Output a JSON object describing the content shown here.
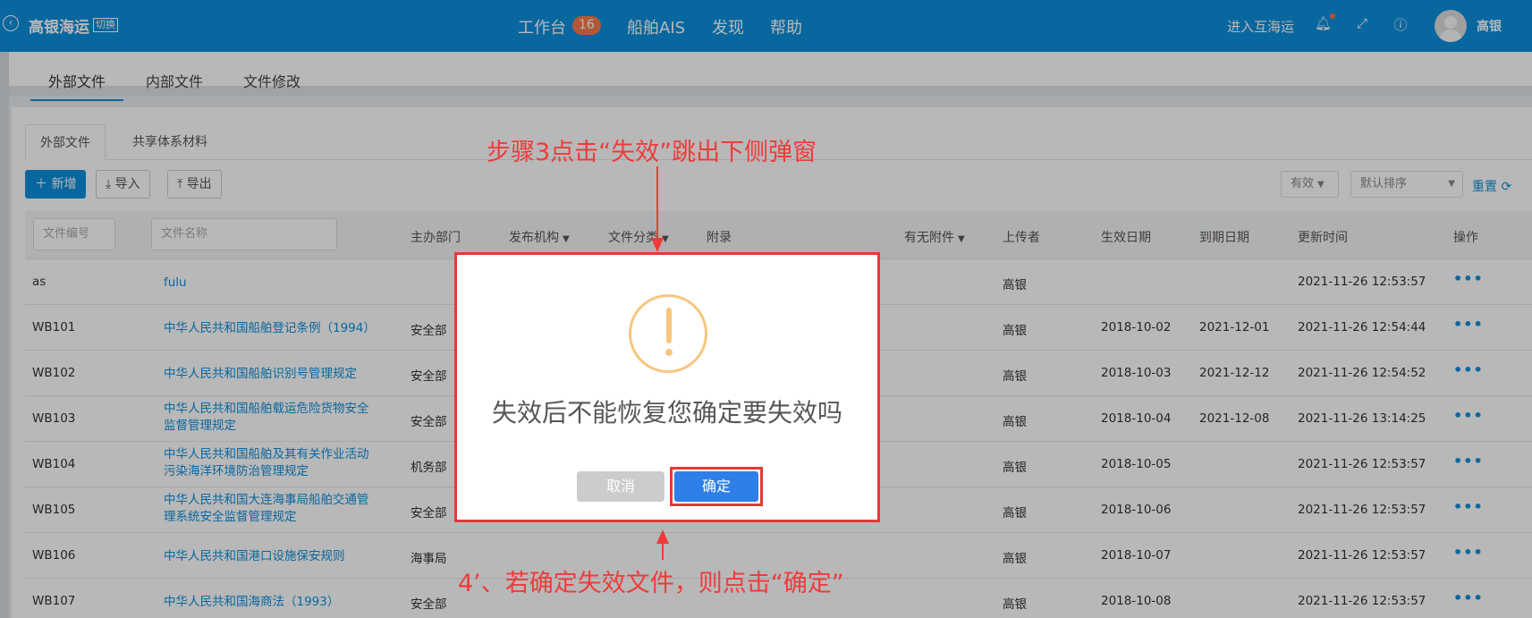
{
  "topbar": {
    "back_icon": "arrow-left-circle-icon",
    "company": "高银海运",
    "switch": "切换",
    "nav": [
      {
        "label": "工作台"
      },
      {
        "label": "船舶AIS"
      },
      {
        "label": "发现"
      },
      {
        "label": "帮助"
      }
    ],
    "badge_count": "16",
    "enter_link": "进入互海运",
    "icons": [
      "bell-icon",
      "fullscreen-icon",
      "help-icon"
    ],
    "user_name": "高银"
  },
  "top_tabs": [
    "外部文件",
    "内部文件",
    "文件修改"
  ],
  "sub_tabs": [
    "外部文件",
    "共享体系材料"
  ],
  "toolbar": {
    "add": "新增",
    "import": "导入",
    "export": "导出",
    "status_filter": "有效",
    "sort": "默认排序",
    "reset": "重置"
  },
  "table": {
    "filters": {
      "code_placeholder": "文件编号",
      "name_placeholder": "文件名称"
    },
    "headers": [
      "主办部门",
      "发布机构",
      "文件分类",
      "附录",
      "有无附件",
      "上传者",
      "生效日期",
      "到期日期",
      "更新时间",
      "操作"
    ],
    "rows": [
      {
        "code": "as",
        "name": "fulu",
        "dept": "",
        "uploader": "高银",
        "effective": "",
        "expire": "",
        "updated": "2021-11-26 12:53:57"
      },
      {
        "code": "WB101",
        "name": "中华人民共和国船舶登记条例（1994）",
        "dept": "安全部",
        "uploader": "高银",
        "effective": "2018-10-02",
        "expire": "2021-12-01",
        "updated": "2021-11-26 12:54:44"
      },
      {
        "code": "WB102",
        "name": "中华人民共和国船舶识别号管理规定",
        "dept": "安全部",
        "uploader": "高银",
        "effective": "2018-10-03",
        "expire": "2021-12-12",
        "updated": "2021-11-26 12:54:52"
      },
      {
        "code": "WB103",
        "name": "中华人民共和国船舶载运危险货物安全监督管理规定",
        "dept": "安全部",
        "uploader": "高银",
        "effective": "2018-10-04",
        "expire": "2021-12-08",
        "updated": "2021-11-26 13:14:25"
      },
      {
        "code": "WB104",
        "name": "中华人民共和国船舶及其有关作业活动污染海洋环境防治管理规定",
        "dept": "机务部",
        "uploader": "高银",
        "effective": "2018-10-05",
        "expire": "",
        "updated": "2021-11-26 12:53:57"
      },
      {
        "code": "WB105",
        "name": "中华人民共和国大连海事局船舶交通管理系统安全监督管理规定",
        "dept": "安全部",
        "uploader": "高银",
        "effective": "2018-10-06",
        "expire": "",
        "updated": "2021-11-26 12:53:57"
      },
      {
        "code": "WB106",
        "name": "中华人民共和国港口设施保安规则",
        "dept": "海事局",
        "uploader": "高银",
        "effective": "2018-10-07",
        "expire": "",
        "updated": "2021-11-26 12:53:57"
      },
      {
        "code": "WB107",
        "name": "中华人民共和国海商法（1993）",
        "dept": "安全部",
        "uploader": "高银",
        "effective": "2018-10-08",
        "expire": "",
        "updated": "2021-11-26 12:53:57"
      }
    ],
    "more_label": "•••"
  },
  "dialog": {
    "icon": "warning-icon",
    "message": "失效后不能恢复您确定要失效吗",
    "cancel": "取消",
    "confirm": "确定"
  },
  "annotations": {
    "step3": "步骤3点击“失效”跳出下侧弹窗",
    "step4": "4’、若确定失效文件，则点击“确定”",
    "color": "#ef3b3b"
  },
  "colors": {
    "brand": "#0d8fdd",
    "confirm": "#2f7fe8",
    "warning": "#f7c67e"
  }
}
